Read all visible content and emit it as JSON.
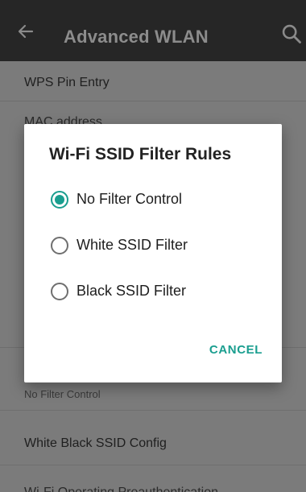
{
  "appbar": {
    "title": "Advanced WLAN",
    "back_icon": "arrow-left-icon",
    "search_icon": "search-icon",
    "background": "#262626"
  },
  "list": {
    "items": [
      {
        "label": "WPS Pin Entry"
      },
      {
        "label": "MAC address"
      },
      {
        "label": "",
        "summary": "No Filter Control"
      },
      {
        "label": "White Black SSID Config"
      },
      {
        "label": "Wi-Fi Operating Preauthentication"
      }
    ]
  },
  "dialog": {
    "title": "Wi-Fi SSID Filter Rules",
    "options": [
      {
        "label": "No Filter Control",
        "selected": true
      },
      {
        "label": "White SSID Filter",
        "selected": false
      },
      {
        "label": "Black SSID Filter",
        "selected": false
      }
    ],
    "cancel_label": "CANCEL",
    "accent": "#1a9e8f"
  }
}
